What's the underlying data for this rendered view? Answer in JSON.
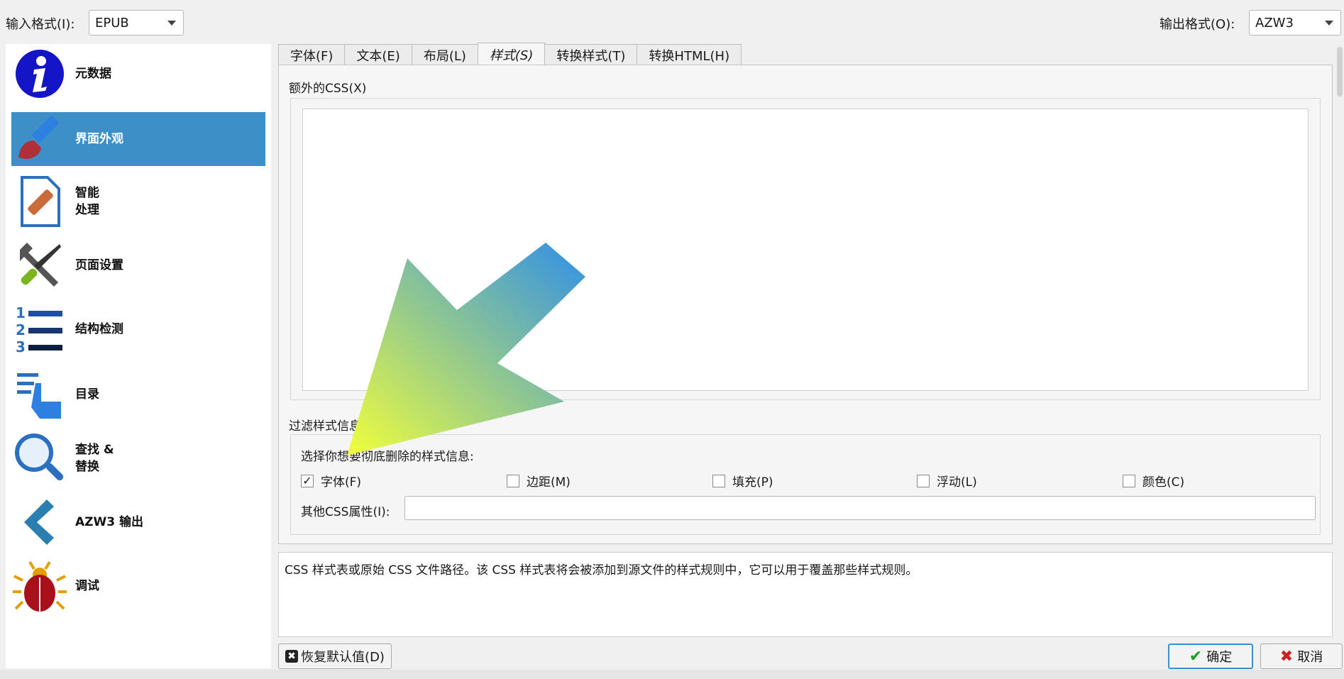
{
  "top": {
    "input_format_label": "输入格式(I):",
    "input_format_value": "EPUB",
    "output_format_label": "输出格式(O):",
    "output_format_value": "AZW3"
  },
  "sidebar": {
    "items": [
      {
        "label": "元数据",
        "icon": "info-icon"
      },
      {
        "label": "界面外观",
        "icon": "paintbrush-icon",
        "active": true
      },
      {
        "label": "智能\n处理",
        "icon": "document-bandage-icon"
      },
      {
        "label": "页面设置",
        "icon": "tools-icon"
      },
      {
        "label": "结构检测",
        "icon": "numbered-list-icon"
      },
      {
        "label": "目录",
        "icon": "toc-hand-icon"
      },
      {
        "label": "查找 &\n替换",
        "icon": "magnifier-icon"
      },
      {
        "label": "AZW3 输出",
        "icon": "azw3-chevron-icon"
      },
      {
        "label": "调试",
        "icon": "bug-icon"
      }
    ]
  },
  "tabs": [
    "字体(F)",
    "文本(E)",
    "布局(L)",
    "样式(S)",
    "转换样式(T)",
    "转换HTML(H)"
  ],
  "active_tab": "样式(S)",
  "extra_css": {
    "label": "额外的CSS(X)",
    "value": ""
  },
  "filter": {
    "title": "过滤样式信息",
    "prompt": "选择你想要彻底删除的样式信息:",
    "options": [
      {
        "label": "字体(F)",
        "checked": true
      },
      {
        "label": "边距(M)",
        "checked": false
      },
      {
        "label": "填充(P)",
        "checked": false
      },
      {
        "label": "浮动(L)",
        "checked": false
      },
      {
        "label": "颜色(C)",
        "checked": false
      }
    ],
    "other_label": "其他CSS属性(I):",
    "other_value": ""
  },
  "help_text": "CSS 样式表或原始 CSS 文件路径。该 CSS 样式表将会被添加到源文件的样式规则中，它可以用于覆盖那些样式规则。",
  "buttons": {
    "restore": "恢复默认值(D)",
    "ok": "确定",
    "cancel": "取消"
  },
  "colors": {
    "accent": "#3d90c7",
    "arrow_start": "#2f8fe8",
    "arrow_end": "#f1ff3a"
  }
}
